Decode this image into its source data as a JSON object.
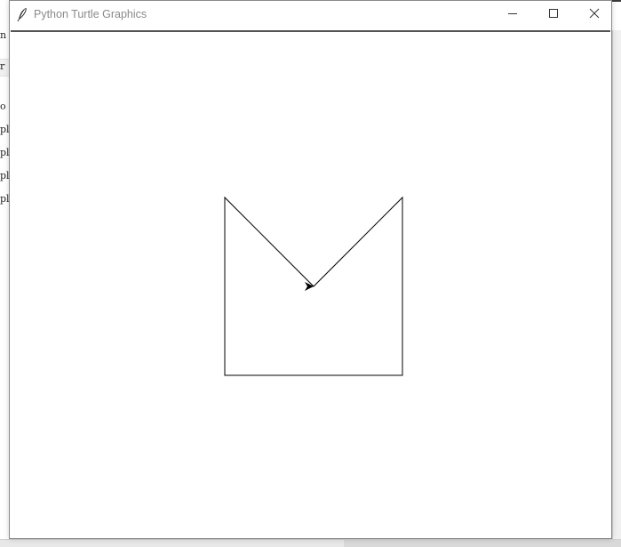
{
  "window": {
    "title": "Python Turtle Graphics",
    "app_icon": "feather-icon",
    "controls": {
      "minimize_icon": "minimize-icon",
      "maximize_icon": "maximize-icon",
      "close_icon": "close-icon"
    }
  },
  "background_window": {
    "visible_fragments": [
      "n",
      "r",
      "o",
      "pl",
      "pl",
      "pl",
      "pl"
    ]
  },
  "canvas": {
    "background_color": "#ffffff",
    "pen_color": "#000000",
    "turtle_shape": "classic-arrow",
    "turtle_heading": "east",
    "drawing_description_text": ""
  }
}
